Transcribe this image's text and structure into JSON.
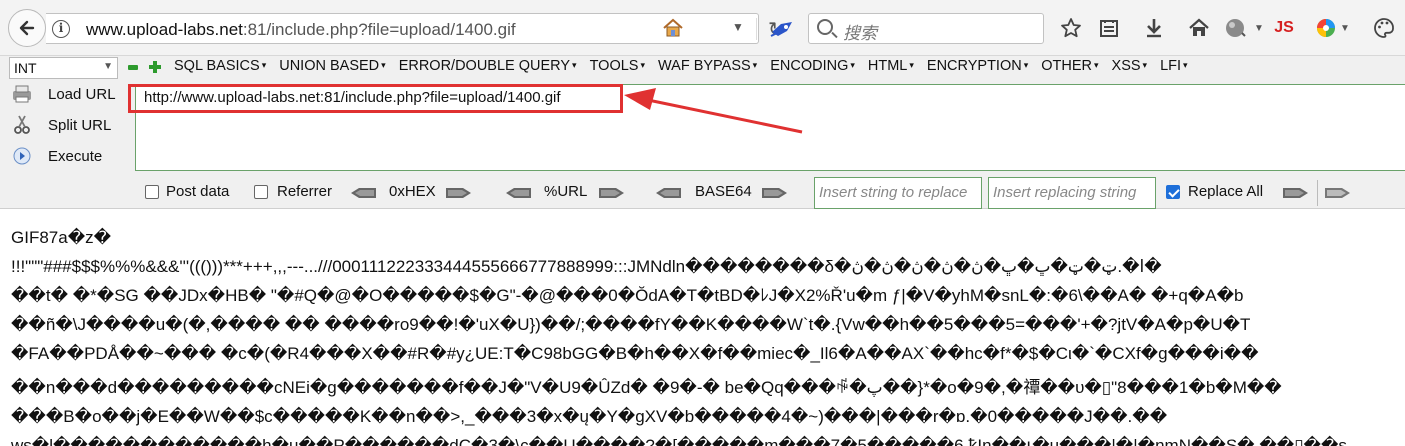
{
  "browser": {
    "url_host": "www.upload-labs.net",
    "url_rest": ":81/include.php?file=upload/1400.gif",
    "search_placeholder": "搜索"
  },
  "hackbar": {
    "select_value": "INT",
    "menu": [
      "SQL BASICS",
      "UNION BASED",
      "ERROR/DOUBLE QUERY",
      "TOOLS",
      "WAF BYPASS",
      "ENCODING",
      "HTML",
      "ENCRYPTION",
      "OTHER",
      "XSS",
      "LFI"
    ],
    "buttons": {
      "load_url": "Load URL",
      "split_url": "Split URL",
      "execute": "Execute"
    },
    "url_value": "http://www.upload-labs.net:81/include.php?file=upload/1400.gif",
    "options": {
      "post_data": "Post data",
      "referrer": "Referrer",
      "hex": "0xHEX",
      "url": "%URL",
      "base64": "BASE64",
      "replace_placeholder": "Insert string to replace",
      "replacing_placeholder": "Insert replacing string",
      "replace_all": "Replace All",
      "post_data_checked": false,
      "referrer_checked": false,
      "replace_all_checked": true
    }
  },
  "content": {
    "lines": [
      "GIF87a�z�",
      "!!!\"\"\"###$$$%%%&&&'''((()))***+++,,,---...///000111222333444555666777888999:::JMNdln��������δ�ا�.ټ�ټ�ڀ�ڀ�ڽ�ڽ�ڽ�ڽ�ڽ�",
      "��t� �*�SG ��JDx�HB� \"�#Q�@�O�����$�G\"-�@���0�ŎdA�T�tBD�ﾚJ�X2%Ř'u�m ƒ|�V�yhM�snL�:�6\\��A� �+q�A�b",
      "��ñ�\\J����u�(�,���� �� ����ro9��!�'uX�U})��/;����fY��K����W`t�.{Vw��h��5���5=���'+�?jtV�A�p�U�T",
      "�FA��PDÅ��~��� �c�(�R4���X��#R�#y¿UE:T�C98bGG�B�h��X�f��miec�_Il6�A��AX`��hc�f*�$�Cι�`�CXf�g���i��",
      "��n���d���������cNEi�g�������f��J�\"V�U9�ÛZd� �9�-� be�Qq���ꆷ�پ��}*�o�9�,�禫��υ�▯\"8���1�b�M��",
      "���B�o��j�E��W��$c�����K��n��>,_���3�x�ų�Y�gXV�b�����4�~)���|���r�ɒ.�0�����J��.��",
      "ws�l������������h�u��P������dC�3�\\c��U����?�[�����m���7�5�����6 ꝅIn��ꙇ�u���|�|�nmN��S�  ��▯��s"
    ]
  }
}
